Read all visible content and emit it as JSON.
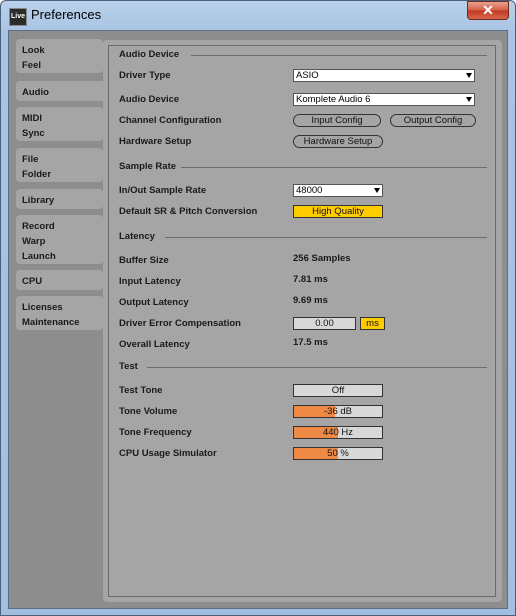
{
  "window": {
    "title": "Preferences",
    "app_icon": "Live",
    "close": "✕"
  },
  "tabs": [
    {
      "lines": [
        "Look",
        "Feel"
      ]
    },
    {
      "lines": [
        "Audio"
      ]
    },
    {
      "lines": [
        "MIDI",
        "Sync"
      ]
    },
    {
      "lines": [
        "File",
        "Folder"
      ]
    },
    {
      "lines": [
        "Library"
      ]
    },
    {
      "lines": [
        "Record",
        "Warp",
        "Launch"
      ]
    },
    {
      "lines": [
        "CPU"
      ]
    },
    {
      "lines": [
        "Licenses",
        "Maintenance"
      ]
    }
  ],
  "audio_device": {
    "section": "Audio Device",
    "driver_type_label": "Driver Type",
    "driver_type_value": "ASIO",
    "audio_device_label": "Audio Device",
    "audio_device_value": "Komplete Audio 6",
    "channel_config_label": "Channel Configuration",
    "input_config": "Input Config",
    "output_config": "Output Config",
    "hardware_setup_label": "Hardware Setup",
    "hardware_setup_button": "Hardware Setup"
  },
  "sample_rate": {
    "section": "Sample Rate",
    "in_out_label": "In/Out Sample Rate",
    "in_out_value": "48000",
    "default_sr_label": "Default SR & Pitch Conversion",
    "default_sr_value": "High Quality"
  },
  "latency": {
    "section": "Latency",
    "buffer_label": "Buffer Size",
    "buffer_value": "256 Samples",
    "input_label": "Input Latency",
    "input_value": "7.81 ms",
    "output_label": "Output Latency",
    "output_value": "9.69 ms",
    "driver_err_label": "Driver Error Compensation",
    "driver_err_value": "0.00",
    "driver_err_unit": "ms",
    "overall_label": "Overall Latency",
    "overall_value": "17.5 ms"
  },
  "test": {
    "section": "Test",
    "tone_label": "Test Tone",
    "tone_value": "Off",
    "volume_label": "Tone Volume",
    "volume_value": "-36 dB",
    "volume_fill": 0.47,
    "freq_label": "Tone Frequency",
    "freq_value": "440 Hz",
    "freq_fill": 0.5,
    "cpu_label": "CPU Usage Simulator",
    "cpu_value": "50 %",
    "cpu_fill": 0.5
  },
  "colors": {
    "accent_yellow": "#ffcc00",
    "slider_orange": "#ee8a45",
    "background": "#8d8d8d"
  }
}
